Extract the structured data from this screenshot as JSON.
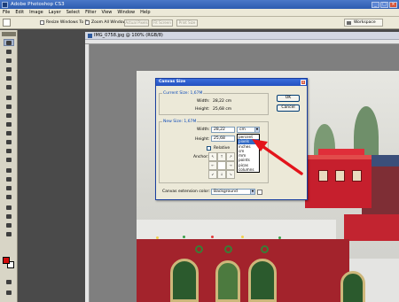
{
  "app": {
    "title": "Adobe Photoshop CS3",
    "window_controls": [
      "_",
      "□",
      "×"
    ]
  },
  "menu": [
    "File",
    "Edit",
    "Image",
    "Layer",
    "Select",
    "Filter",
    "View",
    "Window",
    "Help"
  ],
  "options_bar": {
    "resize_windows_label": "Resize Windows To Fit",
    "zoom_all_label": "Zoom All Windows",
    "actual_pixels": "Actual Pixels",
    "fit_screen": "Fit Screen",
    "print_size": "Print Size",
    "workspace": "Workspace"
  },
  "document": {
    "tab_title": "IMG_0758.jpg @ 100% (RGB/8)"
  },
  "dialog": {
    "title": "Canvas Size",
    "current_size_title": "Current Size: 1,67M",
    "current_width_label": "Width:",
    "current_width_value": "28,22 cm",
    "current_height_label": "Height:",
    "current_height_value": "25,68 cm",
    "new_size_title": "New Size: 1,67M",
    "new_width_label": "Width:",
    "new_width_value": "28,22",
    "new_height_label": "Height:",
    "new_height_value": "25,68",
    "unit_selected": "cm",
    "unit_options": [
      "percent",
      "pixels",
      "inches",
      "cm",
      "mm",
      "points",
      "picas",
      "columns"
    ],
    "unit_highlighted": "pixels",
    "relative_label": "Relative",
    "anchor_label": "Anchor:",
    "extension_color_label": "Canvas extension color:",
    "extension_color_value": "Background",
    "ok_label": "OK",
    "cancel_label": "Cancel"
  },
  "colors": {
    "foreground": "#d20b0b",
    "background": "#ffffff",
    "annotation_arrow": "#e3141b"
  }
}
